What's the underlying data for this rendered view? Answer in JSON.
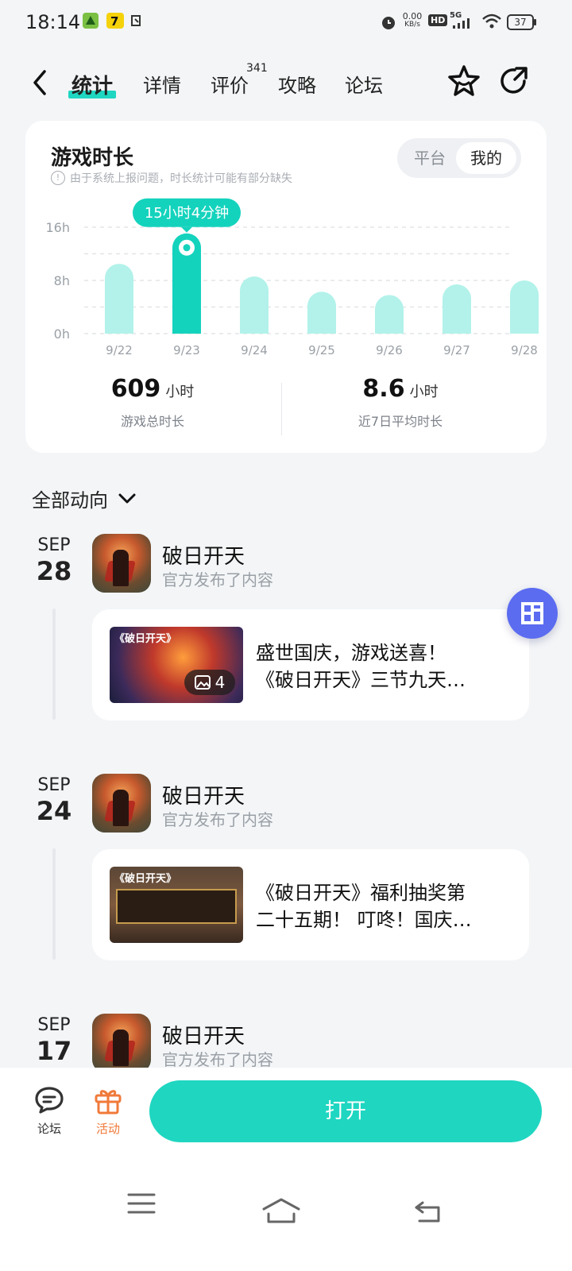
{
  "status_bar": {
    "time": "18:14",
    "net_speed_value": "0.00",
    "net_speed_unit": "KB/s",
    "hd": "HD",
    "signal": "5G",
    "battery": "37",
    "icons": [
      "app-icon-1",
      "app-icon-2",
      "app-icon-3",
      "alarm-icon",
      "hd-icon",
      "signal-icon",
      "wifi-icon",
      "battery-icon"
    ]
  },
  "nav": {
    "tabs": [
      {
        "label": "统计",
        "active": true
      },
      {
        "label": "详情"
      },
      {
        "label": "评价",
        "badge": "341"
      },
      {
        "label": "攻略"
      },
      {
        "label": "论坛"
      }
    ],
    "icons": [
      "back-icon",
      "star-icon",
      "share-icon"
    ]
  },
  "stats_card": {
    "title": "游戏时长",
    "notice": "由于系统上报问题，时长统计可能有部分缺失",
    "segments": [
      "平台",
      "我的"
    ],
    "selected_segment": "我的",
    "total": {
      "value": "609",
      "unit": "小时",
      "caption": "游戏总时长"
    },
    "average": {
      "value": "8.6",
      "unit": "小时",
      "caption": "近7日平均时长"
    }
  },
  "chart_data": {
    "type": "bar",
    "categories": [
      "9/22",
      "9/23",
      "9/24",
      "9/25",
      "9/26",
      "9/27",
      "9/28"
    ],
    "values": [
      10.5,
      15.07,
      8.6,
      6.3,
      5.8,
      7.4,
      8.0
    ],
    "y_ticks": [
      "16h",
      "8h",
      "0h"
    ],
    "ylim": [
      0,
      16
    ],
    "highlight_index": 1,
    "tooltip": "15小时4分钟",
    "colors": {
      "bar": "#b2f2ea",
      "highlight": "#14d3bd"
    },
    "grid": true
  },
  "feed": {
    "filter_label": "全部动向",
    "entries": [
      {
        "month": "SEP",
        "day": "28",
        "game": "破日开天",
        "action": "官方发布了内容",
        "post_lines": [
          "盛世国庆，游戏送喜！",
          "《破日开天》三节九天…"
        ],
        "thumb_title": "《破日开天》",
        "image_count": "4"
      },
      {
        "month": "SEP",
        "day": "24",
        "game": "破日开天",
        "action": "官方发布了内容",
        "post_lines": [
          "《破日开天》福利抽奖第",
          "二十五期！ 叮咚！国庆…"
        ],
        "thumb_title": "《破日开天》"
      },
      {
        "month": "SEP",
        "day": "17",
        "game": "破日开天",
        "action": "官方发布了内容"
      }
    ]
  },
  "bottom_bar": {
    "forum_label": "论坛",
    "activity_label": "活动",
    "open_label": "打开",
    "colors": {
      "accent": "#1fd6c1",
      "activity": "#f07a3a"
    }
  },
  "system_nav": [
    "menu-icon",
    "home-icon",
    "back-nav-icon"
  ]
}
